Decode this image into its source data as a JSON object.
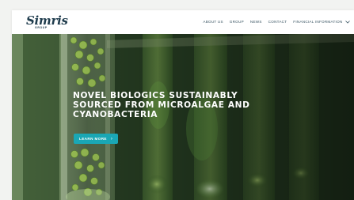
{
  "brand": {
    "name": "Simris",
    "tagline": "GROUP"
  },
  "nav": {
    "items": [
      {
        "label": "ABOUT US"
      },
      {
        "label": "GROUP"
      },
      {
        "label": "NEWS"
      },
      {
        "label": "CONTACT"
      },
      {
        "label": "FINANCIAL INFORMATION"
      }
    ]
  },
  "hero": {
    "headline": [
      "NOVEL BIOLOGICS SUSTAINABLY",
      "SOURCED FROM MICROALGAE AND",
      "CYANOBACTERIA"
    ],
    "cta_label": "LEARN MORE",
    "cta_icon": "chevron-right-icon"
  },
  "colors": {
    "brand": "#1f3c4d",
    "accent": "#1aa7b5",
    "nav_text": "#3a5563",
    "headline": "#ffffff"
  }
}
